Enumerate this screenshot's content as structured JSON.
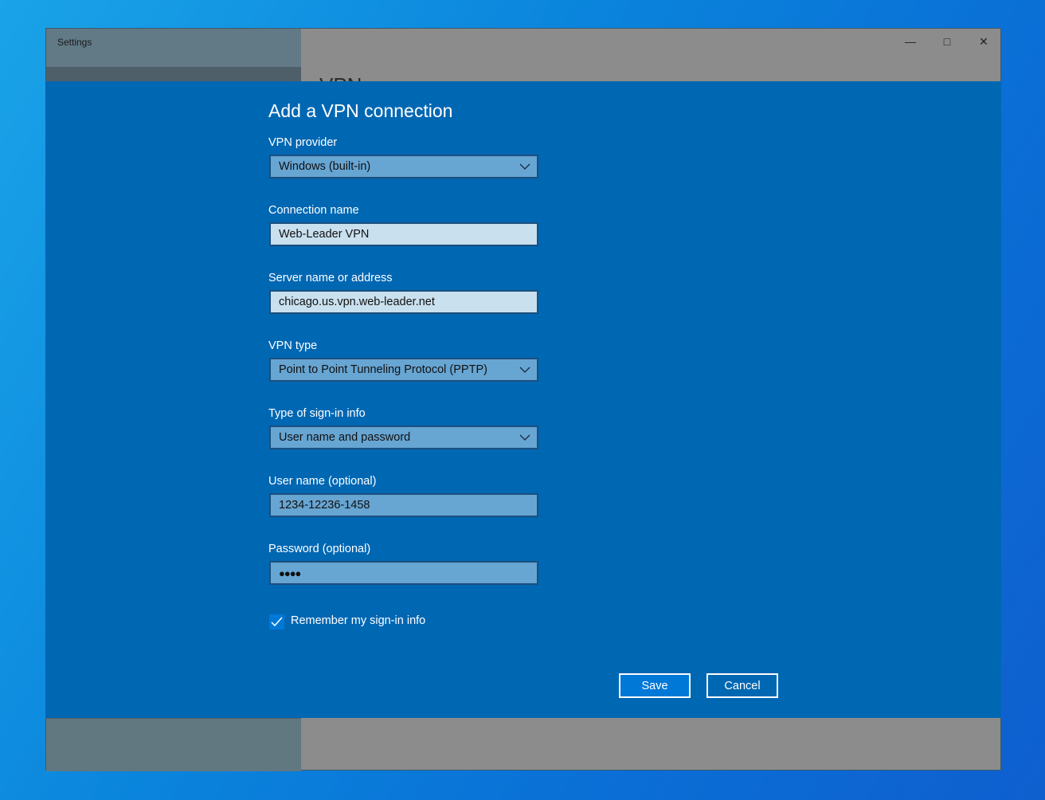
{
  "window": {
    "title": "Settings",
    "page_heading": "VPN"
  },
  "dialog": {
    "title": "Add a VPN connection",
    "fields": [
      {
        "label": "VPN provider",
        "value": "Windows (built-in)",
        "type": "dropdown"
      },
      {
        "label": "Connection name",
        "value": "Web-Leader VPN",
        "type": "text"
      },
      {
        "label": "Server name or address",
        "value": "chicago.us.vpn.web-leader.net",
        "type": "text"
      },
      {
        "label": "VPN type",
        "value": "Point to Point Tunneling Protocol (PPTP)",
        "type": "dropdown"
      },
      {
        "label": "Type of sign-in info",
        "value": "User name and password",
        "type": "dropdown"
      },
      {
        "label": "User name (optional)",
        "value": "1234-12236-1458",
        "type": "text"
      },
      {
        "label": "Password (optional)",
        "value": "●●●●",
        "type": "password"
      }
    ],
    "remember": {
      "label": "Remember my sign-in info",
      "checked": true
    },
    "save_label": "Save",
    "cancel_label": "Cancel"
  },
  "colors": {
    "dialog": "#0067b3",
    "accent": "#0078d7"
  }
}
